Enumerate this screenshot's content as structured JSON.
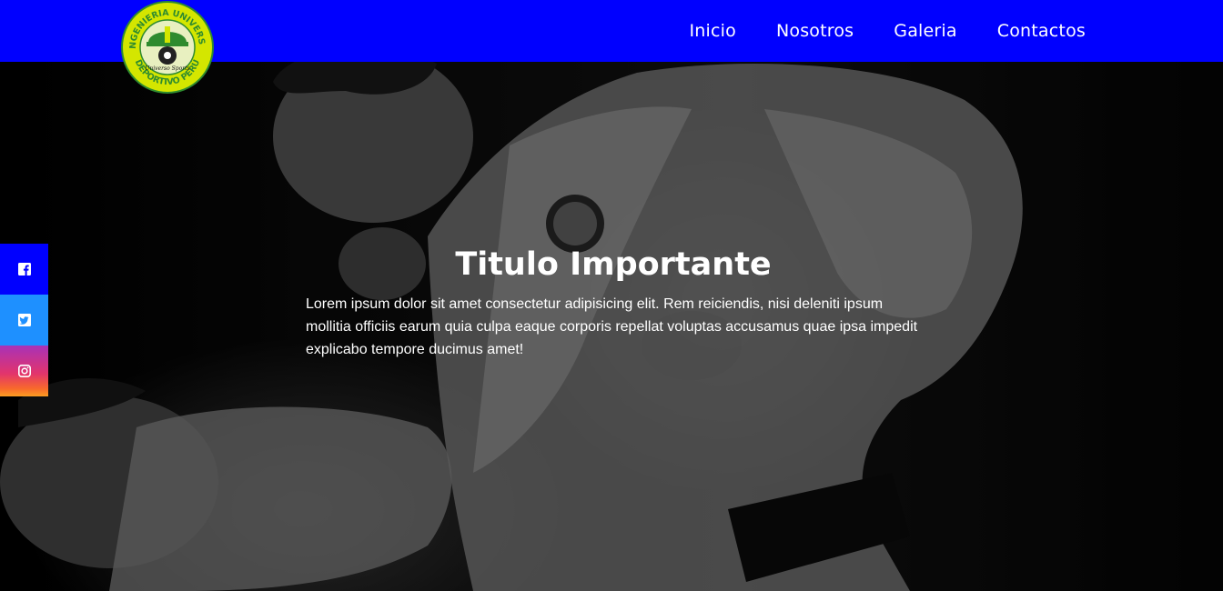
{
  "header": {
    "logo": {
      "text_top": "INGENIERIA UNIVERSO",
      "text_bottom": "DEPORTIVO PERÚ",
      "signature": "Universo Sports"
    },
    "nav": [
      {
        "label": "Inicio"
      },
      {
        "label": "Nosotros"
      },
      {
        "label": "Galeria"
      },
      {
        "label": "Contactos"
      }
    ]
  },
  "social": [
    {
      "name": "facebook",
      "icon": "facebook-icon",
      "color": "#0000ff"
    },
    {
      "name": "twitter",
      "icon": "twitter-icon",
      "color": "#1e90ff"
    },
    {
      "name": "instagram",
      "icon": "instagram-icon",
      "color": "#e2346c"
    }
  ],
  "hero": {
    "title": "Titulo Importante",
    "text": "Lorem ipsum dolor sit amet consectetur adipisicing elit. Rem reiciendis, nisi deleniti ipsum mollitia officiis earum quia culpa eaque corporis repellat voluptas accusamus quae ipsa impedit explicabo tempore ducimus amet!"
  },
  "colors": {
    "header_bg": "#0000ff",
    "logo_yellow": "#d4e600",
    "logo_green": "#2e8b2e"
  }
}
